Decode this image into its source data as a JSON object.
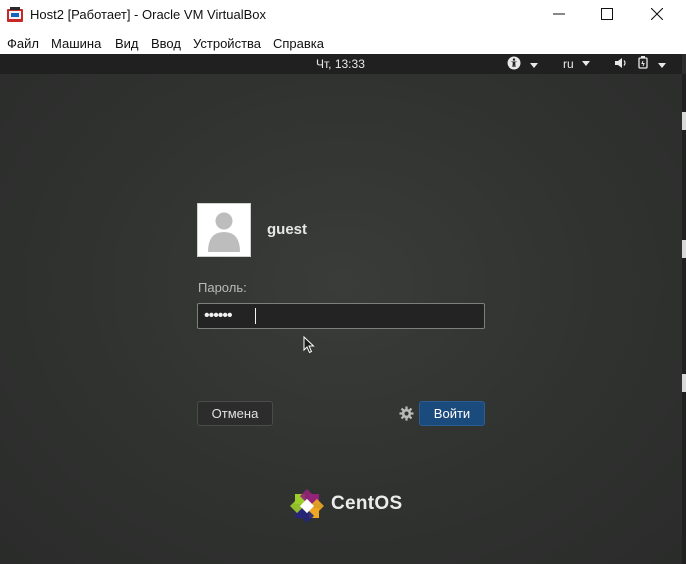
{
  "window": {
    "title": "Host2 [Работает] - Oracle VM VirtualBox",
    "app_icon": "virtualbox-icon",
    "controls": [
      "minimize-icon",
      "maximize-icon",
      "close-icon"
    ]
  },
  "menubar": {
    "items": [
      {
        "label": "Файл"
      },
      {
        "label": "Машина"
      },
      {
        "label": "Вид"
      },
      {
        "label": "Ввод"
      },
      {
        "label": "Устройства"
      },
      {
        "label": "Справка"
      }
    ]
  },
  "guest": {
    "topbar": {
      "clock": "Чт, 13:33",
      "accessibility_icon": "accessibility-icon",
      "language": "ru",
      "volume_icon": "volume-icon",
      "power_icon": "power-icon"
    },
    "login": {
      "username": "guest",
      "password_label": "Пароль:",
      "password_mask": "••••••",
      "cancel_label": "Отмена",
      "login_label": "Войти",
      "settings_icon": "gear-icon"
    },
    "brand": "CentOS"
  },
  "colors": {
    "screen_bg": "#313331",
    "topbar_bg": "#1f201f",
    "login_button": "#1b4a7c",
    "titlebar_bg": "#ffffff"
  }
}
